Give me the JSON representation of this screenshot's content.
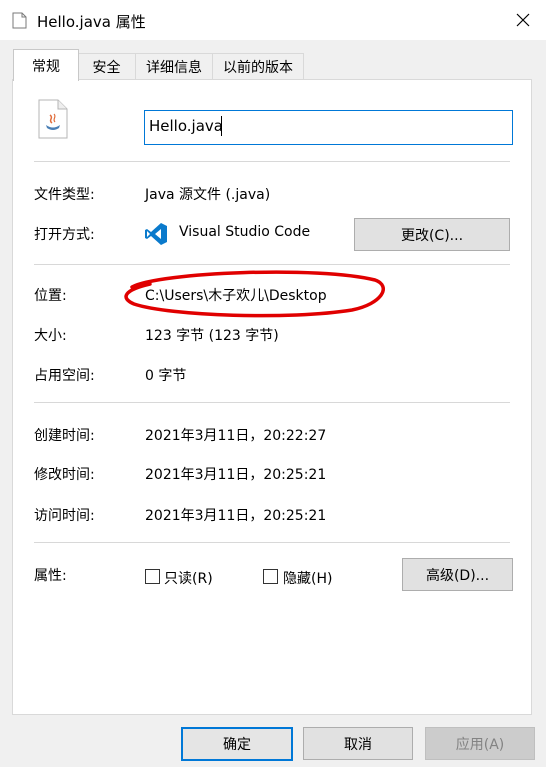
{
  "window": {
    "title": "Hello.java 属性",
    "close_glyph": "✕"
  },
  "tabs": [
    {
      "label": "常规"
    },
    {
      "label": "安全"
    },
    {
      "label": "详细信息"
    },
    {
      "label": "以前的版本"
    }
  ],
  "general": {
    "filename": "Hello.java",
    "file_type_label": "文件类型:",
    "file_type_value": "Java 源文件 (.java)",
    "opens_with_label": "打开方式:",
    "opens_with_value": "Visual Studio Code",
    "change_button": "更改(C)...",
    "location_label": "位置:",
    "location_value": "C:\\Users\\木子欢儿\\Desktop",
    "size_label": "大小:",
    "size_value": "123 字节 (123 字节)",
    "size_on_disk_label": "占用空间:",
    "size_on_disk_value": "0 字节",
    "created_label": "创建时间:",
    "created_value": "2021年3月11日，20:22:27",
    "modified_label": "修改时间:",
    "modified_value": "2021年3月11日，20:25:21",
    "accessed_label": "访问时间:",
    "accessed_value": "2021年3月11日，20:25:21",
    "attributes_label": "属性:",
    "readonly_label": "只读(R)",
    "hidden_label": "隐藏(H)",
    "advanced_button": "高级(D)..."
  },
  "footer": {
    "ok": "确定",
    "cancel": "取消",
    "apply": "应用(A)"
  },
  "colors": {
    "accent": "#0078d7",
    "annotation": "#e00000",
    "vscode_blue": "#0a7acc"
  },
  "icons": {
    "java_file": "java-file-icon",
    "vscode": "vscode-icon"
  }
}
